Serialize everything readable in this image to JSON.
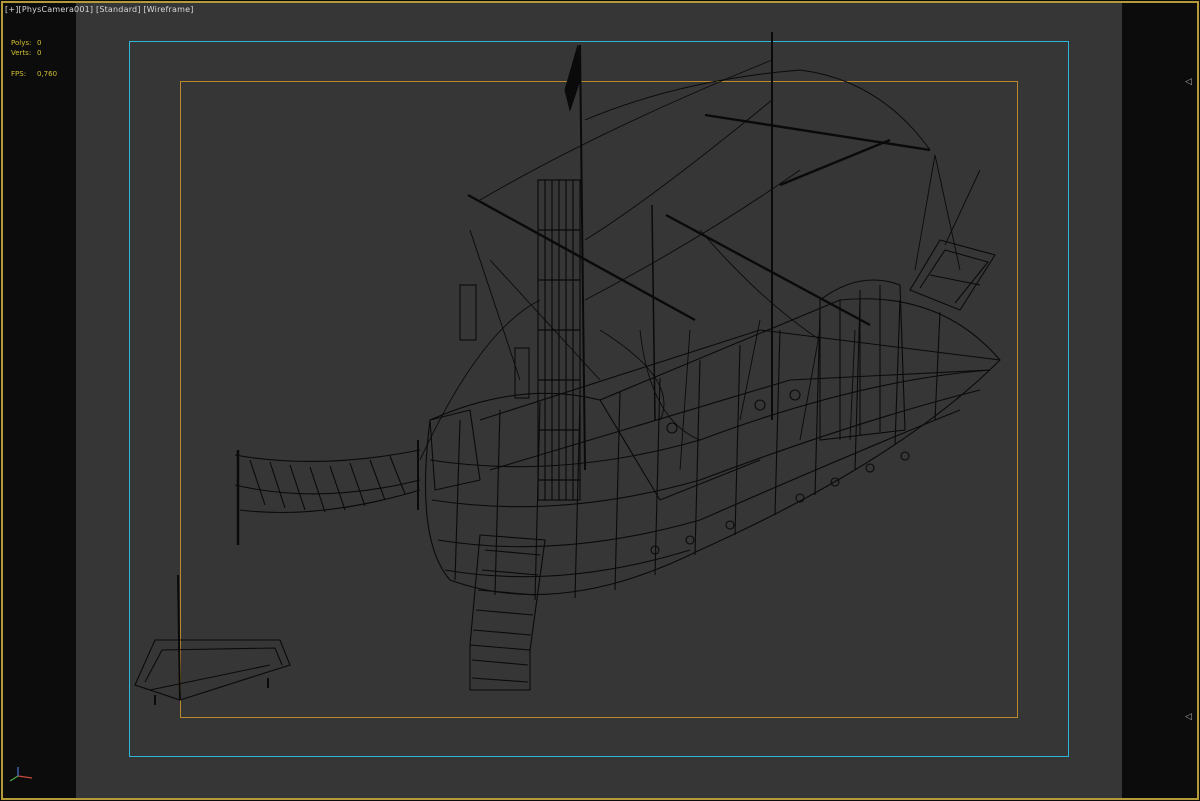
{
  "viewport": {
    "label_plus": "[+]",
    "label_camera": "[PhysCamera001]",
    "label_shading": "[Standard]",
    "label_mode": "[Wireframe]"
  },
  "stats": {
    "polys_label": "Polys:",
    "polys_value": "0",
    "verts_label": "Verts:",
    "verts_value": "0",
    "fps_label": "FPS:",
    "fps_value": "0,760"
  },
  "icons": {
    "right_top": "arrow-left-icon",
    "right_bottom": "arrow-left-icon",
    "gizmo": "axis-gizmo-icon"
  },
  "colors": {
    "frame_border": "#b59a3a",
    "safe_frame": "#2fb6d6",
    "action_frame": "#b8892d",
    "viewport_bg": "#363636",
    "stats_text": "#d3c232"
  }
}
